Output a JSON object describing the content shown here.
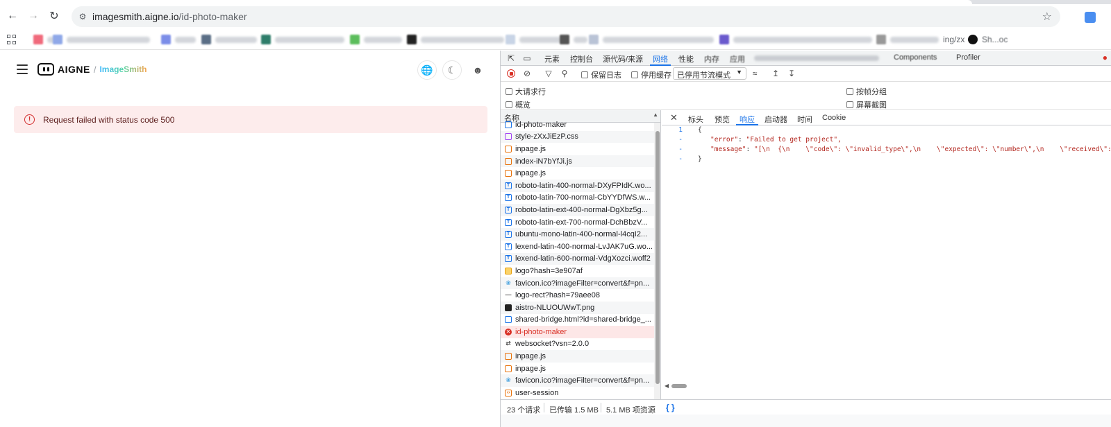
{
  "browser": {
    "url_host": "imagesmith.aigne.io",
    "url_path": "/id-photo-maker",
    "bookmarks": [
      {
        "text": "ing/zx"
      },
      {
        "text": "Sh...oc"
      }
    ]
  },
  "page": {
    "brand": "AIGNE",
    "slash": "/",
    "product": "ImageSmith",
    "error_message": "Request failed with status code 500"
  },
  "devtools": {
    "tabs": {
      "elements": "元素",
      "console": "控制台",
      "sources": "源代码/来源",
      "network": "网络",
      "performance": "性能",
      "memory": "内存",
      "application": "应用",
      "components": "Components",
      "profiler": "Profiler"
    },
    "toolbar": {
      "preserve_log": "保留日志",
      "disable_cache": "停用缓存",
      "throttling": "已停用节流模式"
    },
    "options": {
      "big_rows": "大请求行",
      "overview": "概览",
      "group_by_frame": "按帧分组",
      "screenshots": "屏幕截图"
    },
    "list_header": "名称",
    "requests": [
      {
        "name": "id-photo-maker",
        "type": "doc"
      },
      {
        "name": "style-zXxJiEzP.css",
        "type": "css"
      },
      {
        "name": "inpage.js",
        "type": "js"
      },
      {
        "name": "index-iN7bYfJi.js",
        "type": "js"
      },
      {
        "name": "inpage.js",
        "type": "js"
      },
      {
        "name": "roboto-latin-400-normal-DXyFPIdK.wo...",
        "type": "font"
      },
      {
        "name": "roboto-latin-700-normal-CbYYDfWS.w...",
        "type": "font"
      },
      {
        "name": "roboto-latin-ext-400-normal-DgXbz5g...",
        "type": "font"
      },
      {
        "name": "roboto-latin-ext-700-normal-DchBbzV...",
        "type": "font"
      },
      {
        "name": "ubuntu-mono-latin-400-normal-l4cqI2...",
        "type": "font"
      },
      {
        "name": "lexend-latin-400-normal-LvJAK7uG.wo...",
        "type": "font"
      },
      {
        "name": "lexend-latin-600-normal-VdgXozci.woff2",
        "type": "font"
      },
      {
        "name": "logo?hash=3e907af",
        "type": "img"
      },
      {
        "name": "favicon.ico?imageFilter=convert&f=pn...",
        "type": "ico"
      },
      {
        "name": "logo-rect?hash=79aee08",
        "type": "dash"
      },
      {
        "name": "aistro-NLUOUWwT.png",
        "type": "dark"
      },
      {
        "name": "shared-bridge.html?id=shared-bridge_...",
        "type": "doc"
      },
      {
        "name": "id-photo-maker",
        "type": "err"
      },
      {
        "name": "websocket?vsn=2.0.0",
        "type": "ws"
      },
      {
        "name": "inpage.js",
        "type": "js"
      },
      {
        "name": "inpage.js",
        "type": "js"
      },
      {
        "name": "favicon.ico?imageFilter=convert&f=pn...",
        "type": "ico"
      },
      {
        "name": "user-session",
        "type": "fetch"
      }
    ],
    "detail_tabs": {
      "headers": "标头",
      "preview": "预览",
      "response": "响应",
      "initiator": "启动器",
      "timing": "时间",
      "cookie": "Cookie"
    },
    "response": {
      "line1_no": "1",
      "line1": "{",
      "line2_no": "-",
      "line2_key": "\"error\"",
      "line2_val": "\"Failed to get project\",",
      "line3_no": "-",
      "line3_key": "\"message\"",
      "line3_val": "\"[\\n  {\\n    \\\"code\\\": \\\"invalid_type\\\",\\n    \\\"expected\\\": \\\"number\\\",\\n    \\\"received\\\":",
      "line4_no": "-",
      "line4": "}"
    },
    "status": {
      "requests": "23 个请求",
      "transferred": "已传输 1.5 MB",
      "resources": "5.1 MB 项资源"
    }
  }
}
